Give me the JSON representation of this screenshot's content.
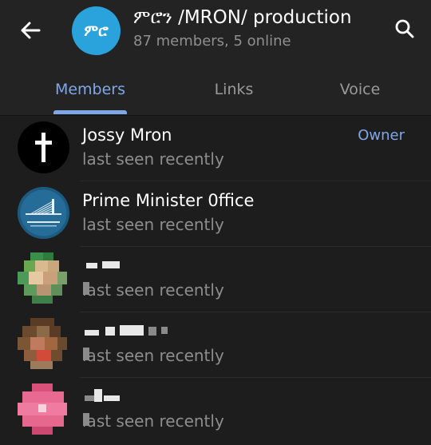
{
  "header": {
    "back_icon": "arrow-left-icon",
    "group_avatar_text": "ምሮ",
    "group_title": "ምሮን /MRON/ production",
    "group_subtitle": "87 members, 5 online",
    "search_icon": "search-icon",
    "avatar_color": "#2aa3dd"
  },
  "tabs": [
    {
      "label": "Members",
      "active": true
    },
    {
      "label": "Links",
      "active": false
    },
    {
      "label": "Voice",
      "active": false
    }
  ],
  "accent_color": "#7fa7e8",
  "members": [
    {
      "name": "Jossy Mron",
      "status": "last seen recently",
      "role": "Owner"
    },
    {
      "name": "Prime Minister 0ffice",
      "status": "last seen recently",
      "role": ""
    },
    {
      "name": "",
      "status": "last seen recently",
      "role": ""
    },
    {
      "name": "",
      "status": "last seen recently",
      "role": ""
    },
    {
      "name": "",
      "status": "last seen recently",
      "role": ""
    }
  ]
}
